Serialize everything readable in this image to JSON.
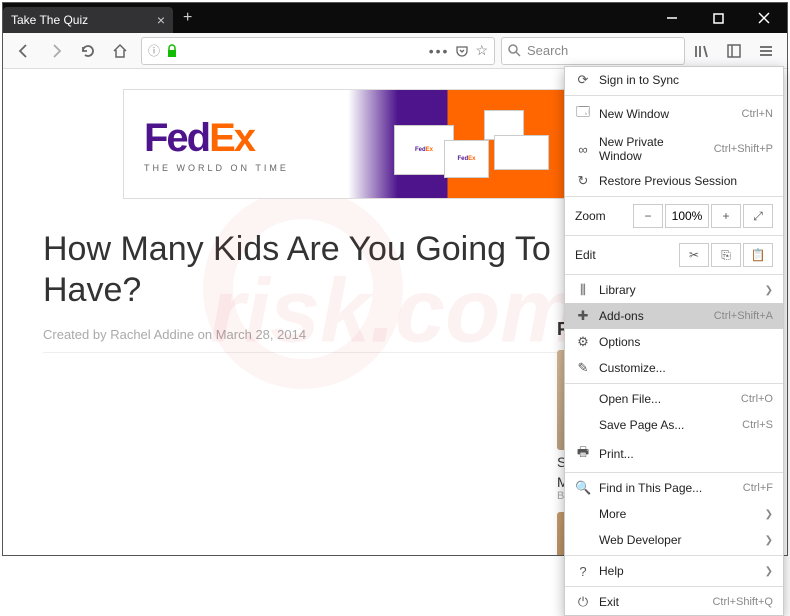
{
  "tab": {
    "title": "Take The Quiz"
  },
  "toolbar": {
    "search_placeholder": "Search"
  },
  "banner": {
    "logo_fed": "Fed",
    "logo_ex": "Ex",
    "tagline": "THE WORLD ON TIME"
  },
  "article": {
    "headline": "How Many Kids Are You Going To Have?",
    "byline": "Created by Rachel Addine on March 28, 2014"
  },
  "sidebar": {
    "header": "From",
    "thumb1_title": "Stud",
    "thumb1_sub": "Mon",
    "thumb1_src": "Brxfina"
  },
  "menu": {
    "sign_in": "Sign in to Sync",
    "new_window": "New Window",
    "new_window_sc": "Ctrl+N",
    "new_private": "New Private Window",
    "new_private_sc": "Ctrl+Shift+P",
    "restore": "Restore Previous Session",
    "zoom_label": "Zoom",
    "zoom_value": "100%",
    "edit_label": "Edit",
    "library": "Library",
    "addons": "Add-ons",
    "addons_sc": "Ctrl+Shift+A",
    "options": "Options",
    "customize": "Customize...",
    "open_file": "Open File...",
    "open_file_sc": "Ctrl+O",
    "save_as": "Save Page As...",
    "save_as_sc": "Ctrl+S",
    "print": "Print...",
    "find": "Find in This Page...",
    "find_sc": "Ctrl+F",
    "more": "More",
    "webdev": "Web Developer",
    "help": "Help",
    "exit": "Exit",
    "exit_sc": "Ctrl+Shift+Q"
  }
}
